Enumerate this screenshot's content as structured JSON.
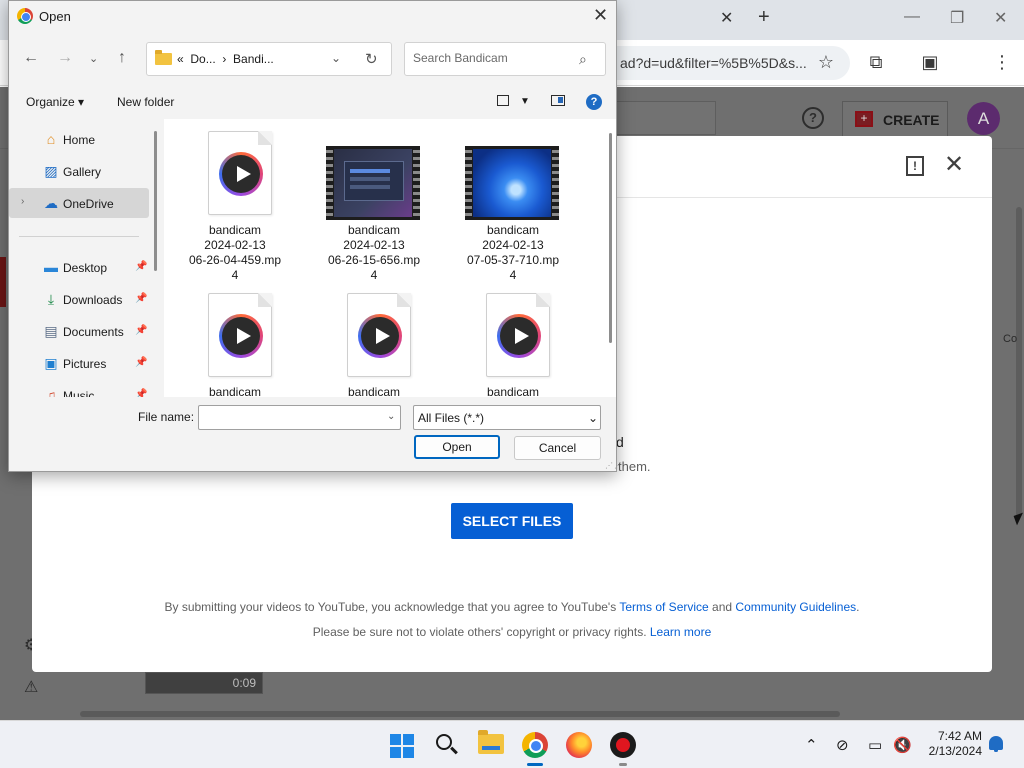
{
  "browser": {
    "url_fragment": "ad?d=ud&filter=%5B%5D&s...",
    "profile_initial": "A"
  },
  "youtube": {
    "create_label": "CREATE",
    "avatar_initial": "A",
    "help_glyph": "?",
    "thumb_duration": "0:09",
    "side_text": "Co"
  },
  "upload": {
    "feedback_glyph": "!",
    "line1": "d",
    "line2": "them.",
    "select_label": "SELECT FILES",
    "terms_prefix": "By submitting your videos to YouTube, you acknowledge that you agree to YouTube's",
    "terms_link": "Terms of Service",
    "terms_and": "and",
    "guidelines_link": "Community Guidelines",
    "terms_end": ".",
    "rights_text": "Please be sure not to violate others' copyright or privacy rights.",
    "learn_more": "Learn more"
  },
  "dialog": {
    "title": "Open",
    "path_prefix": "«",
    "path_part1": "Do...",
    "path_sep": "›",
    "path_part2": "Bandi...",
    "search_placeholder": "Search Bandicam",
    "organize": "Organize",
    "new_folder": "New folder",
    "nav": [
      {
        "label": "Home",
        "icon": "home-icon"
      },
      {
        "label": "Gallery",
        "icon": "gallery-icon"
      },
      {
        "label": "OneDrive",
        "icon": "cloud-icon"
      },
      {
        "label": "Desktop",
        "icon": "desktop-icon"
      },
      {
        "label": "Downloads",
        "icon": "download-icon"
      },
      {
        "label": "Documents",
        "icon": "documents-icon"
      },
      {
        "label": "Pictures",
        "icon": "pictures-icon"
      },
      {
        "label": "Music",
        "icon": "music-icon"
      }
    ],
    "files": [
      {
        "lines": [
          "bandicam",
          "2024-02-13",
          "06-26-04-459.mp",
          "4"
        ],
        "kind": "generic"
      },
      {
        "lines": [
          "bandicam",
          "2024-02-13",
          "06-26-15-656.mp",
          "4"
        ],
        "kind": "thumb-app"
      },
      {
        "lines": [
          "bandicam",
          "2024-02-13",
          "07-05-37-710.mp",
          "4"
        ],
        "kind": "thumb-win"
      },
      {
        "lines": [
          "bandicam"
        ],
        "kind": "generic"
      },
      {
        "lines": [
          "bandicam"
        ],
        "kind": "generic"
      },
      {
        "lines": [
          "bandicam"
        ],
        "kind": "generic"
      }
    ],
    "filename_label": "File name:",
    "filename_value": "",
    "filetype": "All Files (*.*)",
    "open_label": "Open",
    "cancel_label": "Cancel"
  },
  "taskbar": {
    "time": "7:42 AM",
    "date": "2/13/2024"
  }
}
